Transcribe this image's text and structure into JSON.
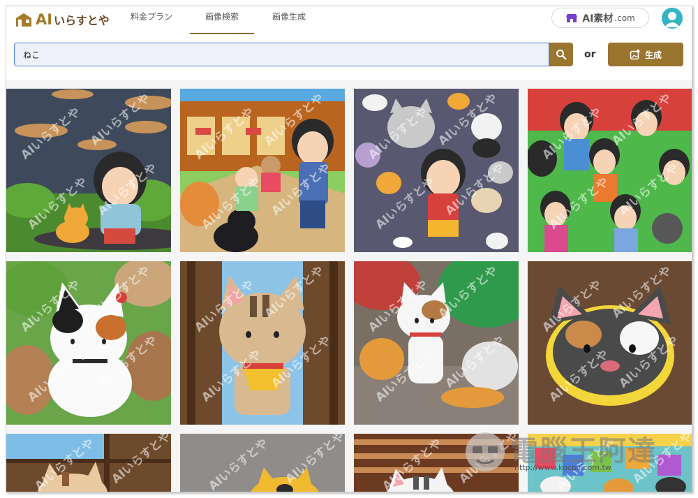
{
  "header": {
    "logo_ai": "AI",
    "logo_jp": "いらすとや",
    "nav": [
      {
        "label": "料金プラン"
      },
      {
        "label": "画像検索"
      },
      {
        "label": "画像生成"
      }
    ],
    "active_nav": "画像検索",
    "sozai_label": "AI素材",
    "sozai_suffix": ".com",
    "avatar_icon": "user-icon"
  },
  "search": {
    "value": "ねこ",
    "button_icon": "search-icon",
    "or_label": "or",
    "generate_label": "生成",
    "generate_icon": "image-plus-icon"
  },
  "grid": {
    "tiles": [
      {
        "name": "girl-with-cat-at-dusk"
      },
      {
        "name": "girl-at-station-with-cats"
      },
      {
        "name": "girl-among-many-cats"
      },
      {
        "name": "crowd-of-children"
      },
      {
        "name": "calico-cat-on-rocks"
      },
      {
        "name": "tabby-cat-in-doorway"
      },
      {
        "name": "cat-under-tree"
      },
      {
        "name": "cat-face-closeup"
      },
      {
        "name": "cat-at-window"
      },
      {
        "name": "yellow-cat-partial"
      },
      {
        "name": "cat-on-striped-wall"
      },
      {
        "name": "colorful-shop-cats"
      }
    ]
  },
  "site_watermark": {
    "title": "電腦王阿達",
    "url": "http://www.kocpc.com.tw"
  },
  "colors": {
    "brand": "#9a7530",
    "focus": "#4a7fd6",
    "avatar": "#33b5c4"
  }
}
